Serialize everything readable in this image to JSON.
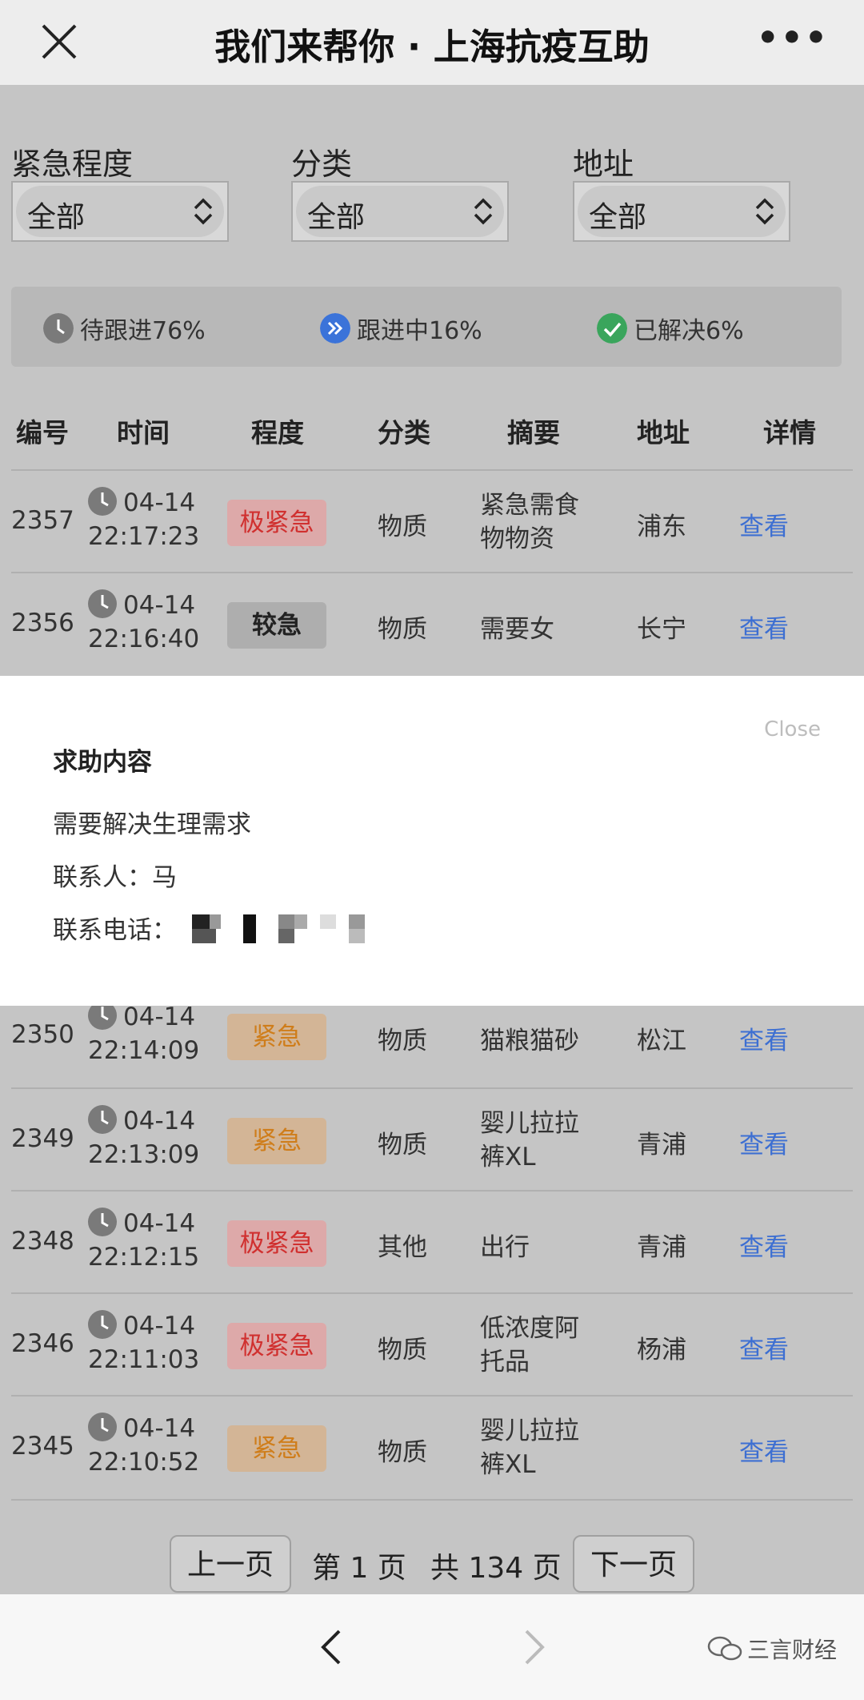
{
  "titlebar": {
    "title": "我们来帮你 · 上海抗疫互助",
    "more": "•••"
  },
  "filters": [
    {
      "label": "紧急程度",
      "value": "全部"
    },
    {
      "label": "分类",
      "value": "全部"
    },
    {
      "label": "地址",
      "value": "全部"
    }
  ],
  "statuses": [
    {
      "label": "待跟进76%",
      "color": "#7a7a7a"
    },
    {
      "label": "跟进中16%",
      "color": "#3b73d9"
    },
    {
      "label": "已解决6%",
      "color": "#3aa55c"
    }
  ],
  "table": {
    "headers": [
      "编号",
      "时间",
      "程度",
      "分类",
      "摘要",
      "地址",
      "详情"
    ],
    "rows": [
      {
        "id": "2357",
        "date": "04-14",
        "time": "22:17:23",
        "level": "极紧急",
        "category": "物质",
        "summary": "紧急需食物物资",
        "address": "浦东",
        "detail": "查看"
      },
      {
        "id": "2356",
        "date": "04-14",
        "time": "22:16:40",
        "level": "较急",
        "category": "物质",
        "summary": "需要女",
        "address": "长宁",
        "detail": "查看"
      },
      {
        "id": "2350",
        "date": "04-14",
        "time": "22:14:09",
        "level": "紧急",
        "category": "物质",
        "summary": "猫粮猫砂",
        "address": "松江",
        "detail": "查看"
      },
      {
        "id": "2349",
        "date": "04-14",
        "time": "22:13:09",
        "level": "紧急",
        "category": "物质",
        "summary": "婴儿拉拉裤XL",
        "address": "青浦",
        "detail": "查看"
      },
      {
        "id": "2348",
        "date": "04-14",
        "time": "22:12:15",
        "level": "极紧急",
        "category": "其他",
        "summary": "出行",
        "address": "青浦",
        "detail": "查看"
      },
      {
        "id": "2346",
        "date": "04-14",
        "time": "22:11:03",
        "level": "极紧急",
        "category": "物质",
        "summary": "低浓度阿托品",
        "address": "杨浦",
        "detail": "查看"
      },
      {
        "id": "2345",
        "date": "04-14",
        "time": "22:10:52",
        "level": "紧急",
        "category": "物质",
        "summary": "婴儿拉拉裤XL",
        "address": "",
        "detail": "查看"
      }
    ]
  },
  "modal": {
    "close": "Close",
    "title": "求助内容",
    "content": "需要解决生理需求",
    "contact": "联系人：马",
    "phone_label": "联系电话："
  },
  "pager": {
    "prev": "上一页",
    "page": "第 1 页",
    "total": "共 134 页",
    "next": "下一页"
  },
  "watermark": "三言财经",
  "colors": {
    "link": "#3d6fd2",
    "urgent_high": "#d0302f",
    "urgent_mid": "#cf7d1a"
  }
}
